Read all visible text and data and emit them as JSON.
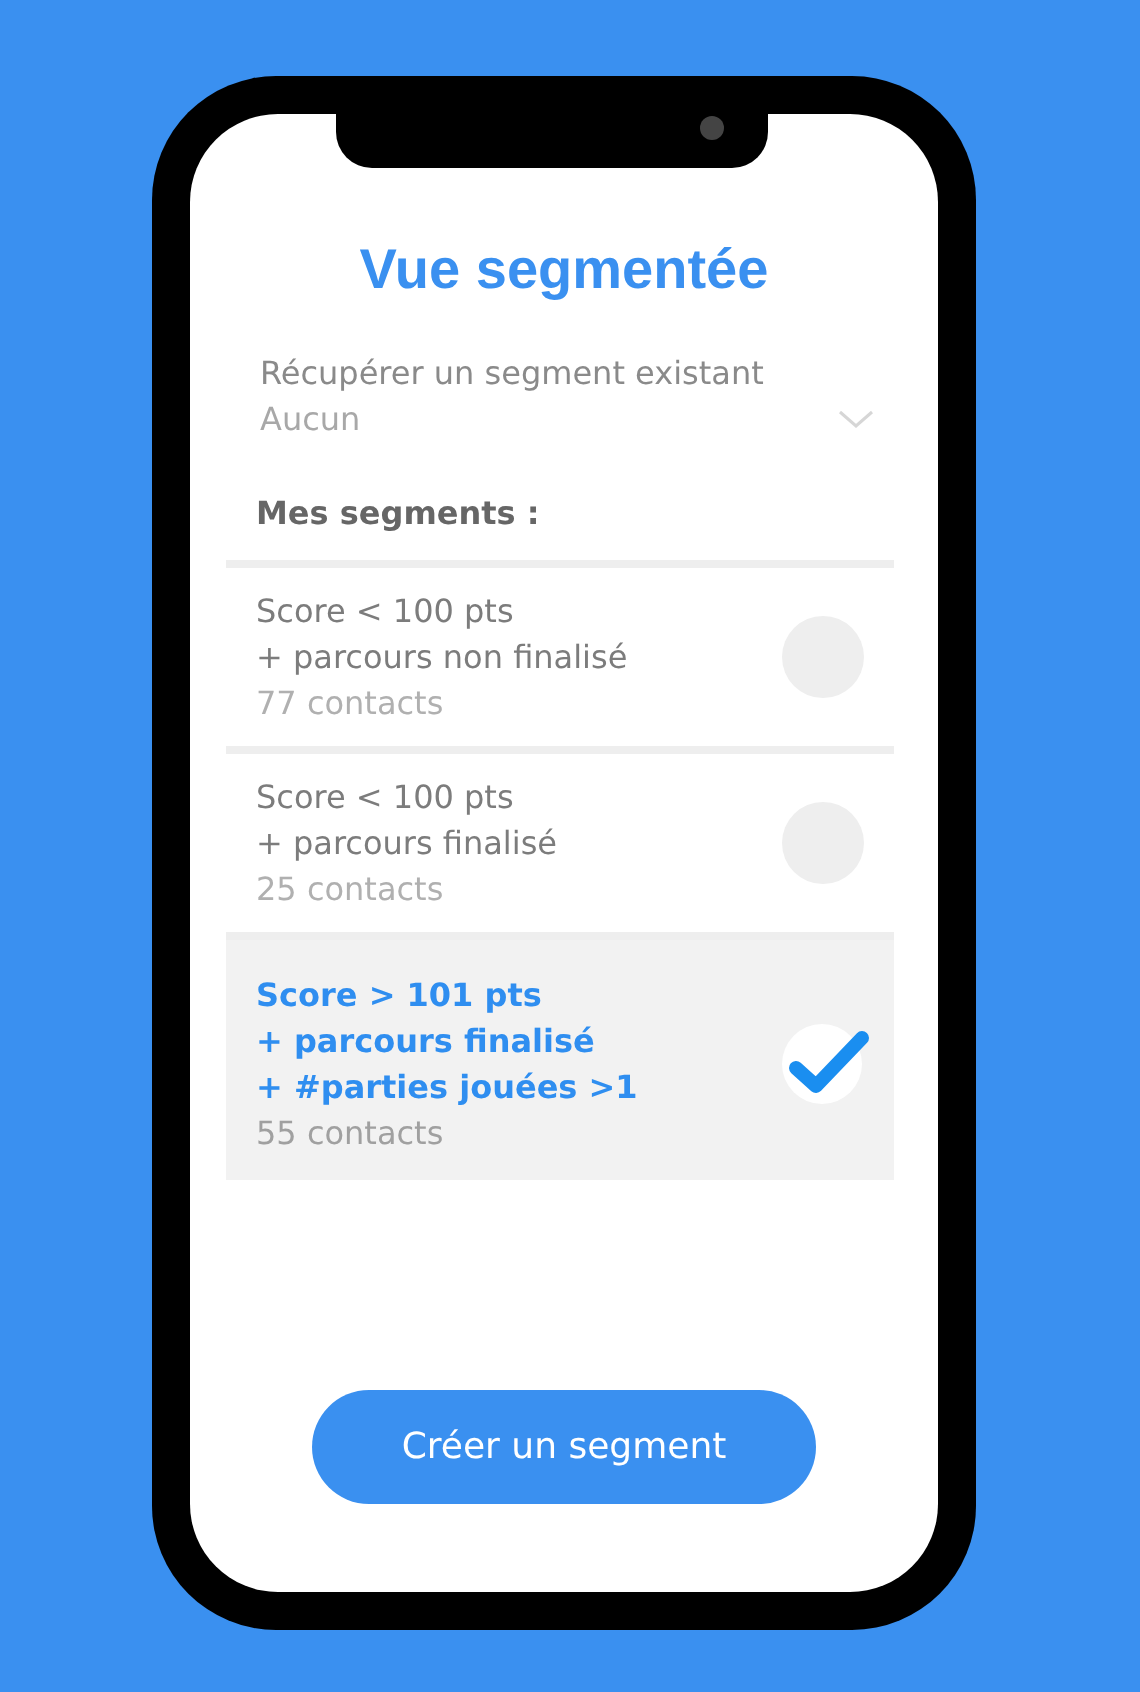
{
  "title": "Vue segmentée",
  "select": {
    "label": "Récupérer un segment existant",
    "placeholder": "Aucun"
  },
  "section_title": "Mes segments :",
  "segments": [
    {
      "lines": [
        "Score < 100 pts",
        "+ parcours non finalisé"
      ],
      "count": "77 contacts",
      "selected": false
    },
    {
      "lines": [
        "Score < 100 pts",
        "+ parcours finalisé"
      ],
      "count": "25 contacts",
      "selected": false
    },
    {
      "lines": [
        "Score > 101 pts",
        "+ parcours finalisé",
        "+ #parties jouées >1"
      ],
      "count": "55 contacts",
      "selected": true
    }
  ],
  "button": "Créer un segment"
}
